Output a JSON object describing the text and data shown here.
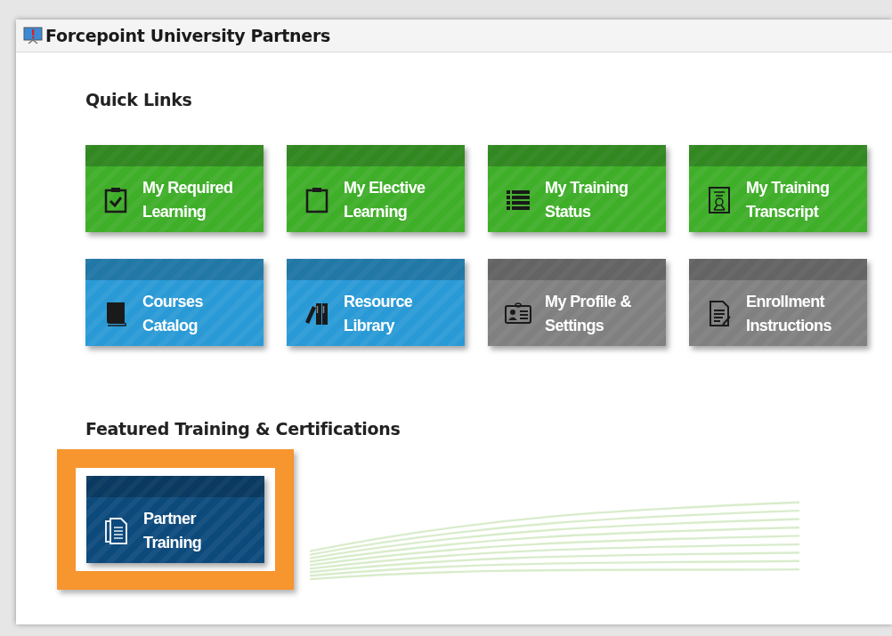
{
  "window": {
    "title": "Forcepoint University Partners"
  },
  "quick_links": {
    "heading": "Quick Links",
    "tiles": [
      {
        "label": "My Required Learning",
        "color": "#3fae29"
      },
      {
        "label": "My Elective Learning",
        "color": "#3fae29"
      },
      {
        "label": "My Training Status",
        "color": "#3fae29"
      },
      {
        "label": "My Training Transcript",
        "color": "#3fae29"
      },
      {
        "label": "Courses Catalog",
        "color": "#2a9ad6"
      },
      {
        "label": "Resource Library",
        "color": "#2a9ad6"
      },
      {
        "label": "My Profile & Settings",
        "color": "#808080"
      },
      {
        "label": "Enrollment Instructions",
        "color": "#808080"
      }
    ]
  },
  "featured": {
    "heading": "Featured Training & Certifications",
    "tiles": [
      {
        "label": "Partner Training",
        "color": "#0d4a7c",
        "highlighted": true
      }
    ]
  }
}
